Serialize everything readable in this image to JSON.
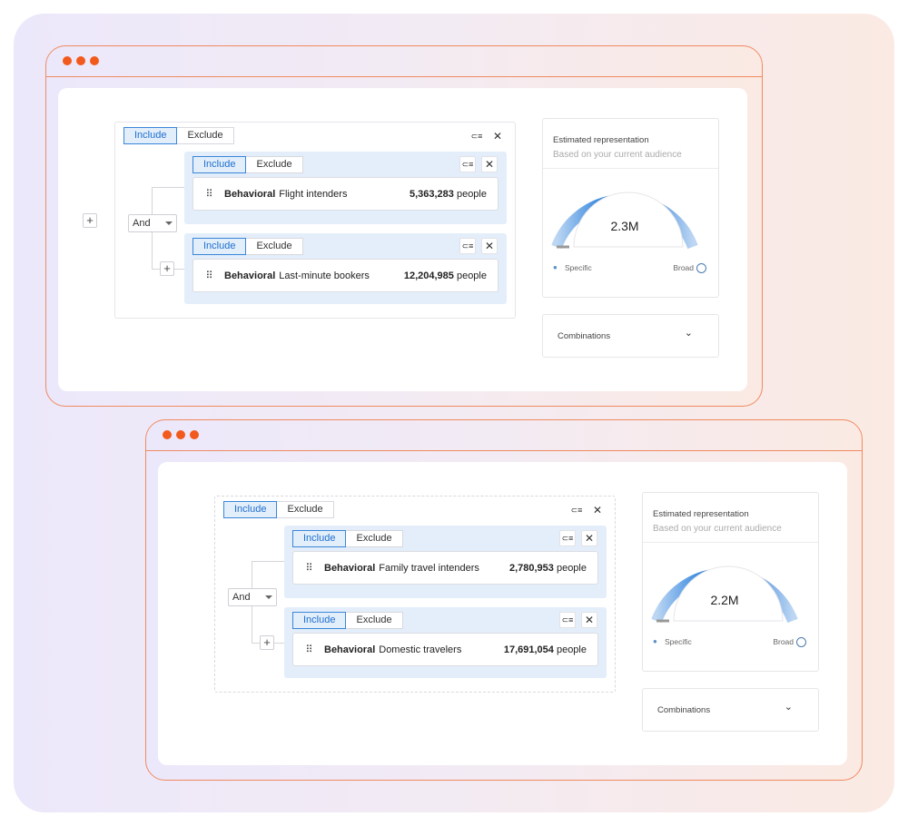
{
  "windows": [
    {
      "top_segment": {
        "include": "Include",
        "exclude": "Exclude"
      },
      "top_icons": {
        "group_icon": "⊂≡",
        "close_icon": "✕"
      },
      "operator": "And",
      "groups": [
        {
          "segment": {
            "include": "Include",
            "exclude": "Exclude"
          },
          "rule": {
            "category": "Behavioral",
            "name": "Flight intenders",
            "count": "5,363,283",
            "unit": "people"
          }
        },
        {
          "segment": {
            "include": "Include",
            "exclude": "Exclude"
          },
          "rule": {
            "category": "Behavioral",
            "name": "Last-minute bookers",
            "count": "12,204,985",
            "unit": "people"
          }
        }
      ],
      "estimate": {
        "title": "Estimated representation",
        "subtitle": "Based on your current audience",
        "value": "2.3M",
        "left_label": "Specific",
        "right_label": "Broad"
      },
      "combinations": {
        "label": "Combinations"
      }
    },
    {
      "top_segment": {
        "include": "Include",
        "exclude": "Exclude"
      },
      "top_icons": {
        "group_icon": "⊂≡",
        "close_icon": "✕"
      },
      "operator": "And",
      "groups": [
        {
          "segment": {
            "include": "Include",
            "exclude": "Exclude"
          },
          "rule": {
            "category": "Behavioral",
            "name": "Family travel intenders",
            "count": "2,780,953",
            "unit": "people"
          }
        },
        {
          "segment": {
            "include": "Include",
            "exclude": "Exclude"
          },
          "rule": {
            "category": "Behavioral",
            "name": "Domestic travelers",
            "count": "17,691,054",
            "unit": "people"
          }
        }
      ],
      "estimate": {
        "title": "Estimated representation",
        "subtitle": "Based on your current audience",
        "value": "2.2M",
        "left_label": "Specific",
        "right_label": "Broad"
      },
      "combinations": {
        "label": "Combinations"
      }
    }
  ],
  "icons": {
    "plus": "+",
    "grip": "⠿",
    "chevron": "⌄",
    "person": "👤"
  },
  "colors": {
    "accent": "#1d6fce",
    "window_border": "#f08a60",
    "window_dot": "#f25a1d",
    "group_bg": "#e3eefa"
  }
}
